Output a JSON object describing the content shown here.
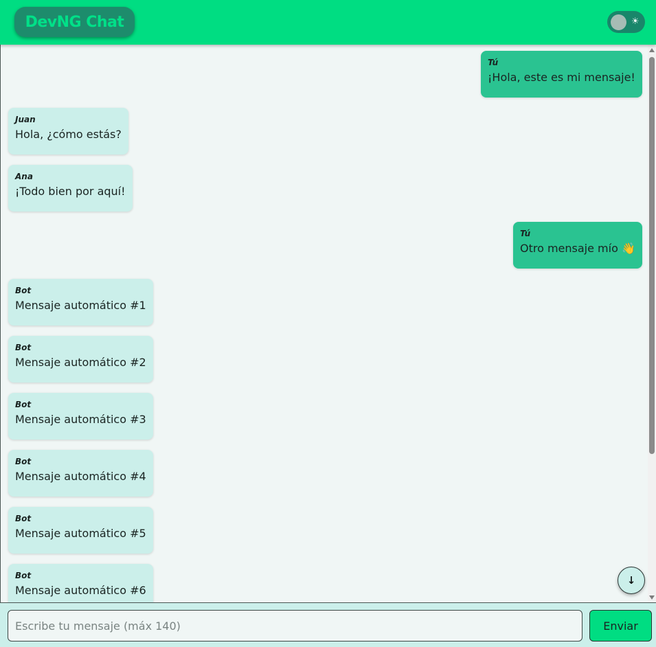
{
  "header": {
    "title": "DevNG Chat",
    "theme_toggle_icon": "☀",
    "theme_toggle_icon_name": "sun-icon"
  },
  "messages": [
    {
      "author": "Tú",
      "text": "¡Hola, este es mi mensaje!",
      "own": true
    },
    {
      "author": "Juan",
      "text": "Hola, ¿cómo estás?",
      "own": false
    },
    {
      "author": "Ana",
      "text": "¡Todo bien por aquí!",
      "own": false
    },
    {
      "author": "Tú",
      "text": "Otro mensaje mío 👋",
      "own": true
    },
    {
      "author": "Bot",
      "text": "Mensaje automático #1",
      "own": false
    },
    {
      "author": "Bot",
      "text": "Mensaje automático #2",
      "own": false
    },
    {
      "author": "Bot",
      "text": "Mensaje automático #3",
      "own": false
    },
    {
      "author": "Bot",
      "text": "Mensaje automático #4",
      "own": false
    },
    {
      "author": "Bot",
      "text": "Mensaje automático #5",
      "own": false
    },
    {
      "author": "Bot",
      "text": "Mensaje automático #6",
      "own": false
    }
  ],
  "scroll_down": {
    "icon": "↓",
    "icon_name": "arrow-down-icon"
  },
  "composer": {
    "placeholder": "Escribe tu mensaje (máx 140)",
    "value": "",
    "send_label": "Enviar"
  },
  "colors": {
    "accent": "#00dd82",
    "own_bubble": "#2ac391",
    "other_bubble": "#cbefea",
    "background": "#f0f6f5"
  }
}
